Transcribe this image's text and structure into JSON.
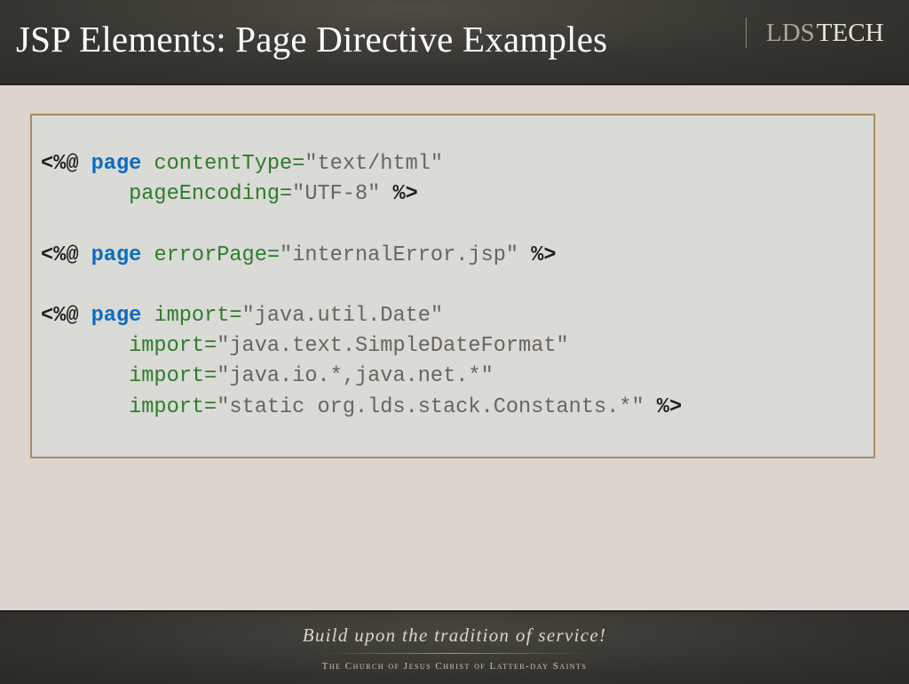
{
  "header": {
    "title": "JSP Elements: Page Directive Examples",
    "logo": {
      "part1": "LDS",
      "part2": "TECH"
    }
  },
  "code_lines": [
    [
      {
        "t": "<%@ ",
        "c": "delim"
      },
      {
        "t": "page",
        "c": "kw"
      },
      {
        "t": " contentType=",
        "c": "attr"
      },
      {
        "t": "\"text/html\"",
        "c": "val"
      }
    ],
    [
      {
        "t": "       pageEncoding=",
        "c": "attr"
      },
      {
        "t": "\"UTF-8\"",
        "c": "val"
      },
      {
        "t": " %>",
        "c": "delim"
      }
    ],
    [],
    [
      {
        "t": "<%@ ",
        "c": "delim"
      },
      {
        "t": "page",
        "c": "kw"
      },
      {
        "t": " errorPage=",
        "c": "attr"
      },
      {
        "t": "\"internalError.jsp\"",
        "c": "val"
      },
      {
        "t": " %>",
        "c": "delim"
      }
    ],
    [],
    [
      {
        "t": "<%@ ",
        "c": "delim"
      },
      {
        "t": "page",
        "c": "kw"
      },
      {
        "t": " import=",
        "c": "attr"
      },
      {
        "t": "\"java.util.Date\"",
        "c": "val"
      }
    ],
    [
      {
        "t": "       import=",
        "c": "attr"
      },
      {
        "t": "\"java.text.SimpleDateFormat\"",
        "c": "val"
      }
    ],
    [
      {
        "t": "       import=",
        "c": "attr"
      },
      {
        "t": "\"java.io.*,java.net.*\"",
        "c": "val"
      }
    ],
    [
      {
        "t": "       import=",
        "c": "attr"
      },
      {
        "t": "\"static org.lds.stack.Constants.*\"",
        "c": "val"
      },
      {
        "t": " %>",
        "c": "delim"
      }
    ]
  ],
  "footer": {
    "tagline": "Build upon the tradition of service!",
    "church": "The Church of Jesus Christ of Latter-day Saints"
  },
  "colors": {
    "keyword": "#0e6bbf",
    "attribute": "#2e7c2b",
    "value": "#6a655a",
    "box_border": "#a88d62"
  }
}
